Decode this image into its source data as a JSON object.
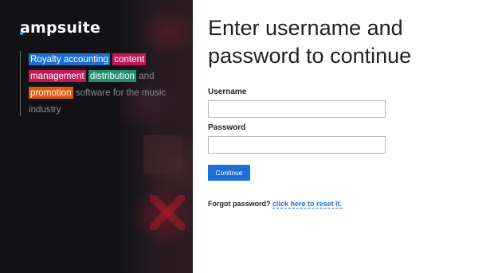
{
  "brand": {
    "logo_text": "ampsuite"
  },
  "tagline": {
    "highlights": {
      "royalty": "Royalty accounting",
      "content": "content",
      "management": "management",
      "distribution": "distribution",
      "promotion": "promotion"
    },
    "and": "and",
    "rest1": "software for the music",
    "rest2": "industry",
    "colors": {
      "royalty": "#1f6fd1",
      "content": "#c2185b",
      "distribution": "#1e8f6d",
      "promotion": "#e05a12"
    }
  },
  "form": {
    "heading_line1": "Enter username and",
    "heading_line2": "password to continue",
    "username_label": "Username",
    "username_value": "",
    "password_label": "Password",
    "password_value": "",
    "continue_label": "Continue",
    "forgot_text": "Forgot password?",
    "reset_link": "click here to reset it.",
    "accent_color": "#1c6fd6"
  }
}
